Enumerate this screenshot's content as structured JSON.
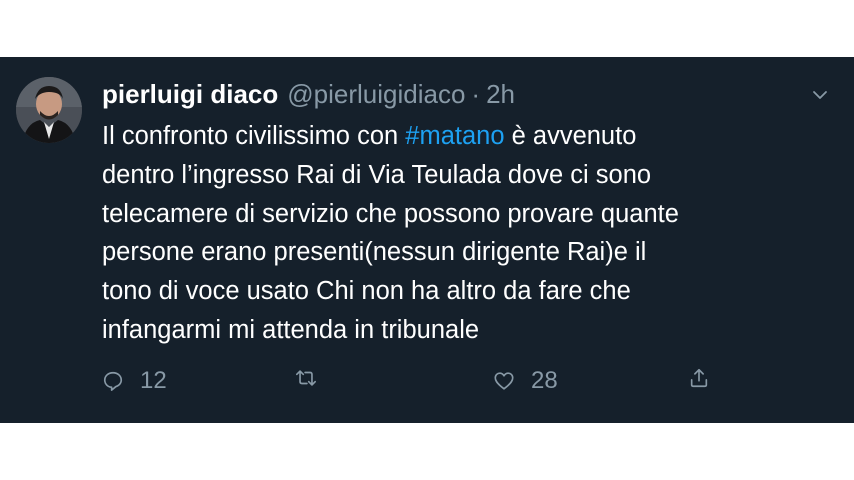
{
  "tweet": {
    "author_name": "pierluigi diaco",
    "handle": "@pierluigidiaco",
    "separator": "·",
    "time": "2h",
    "text_before": "Il confronto civilissimo con ",
    "hashtag": "#matano",
    "text_after": " è avvenuto\ndentro l’ingresso Rai di Via Teulada dove ci sono\ntelecamere di servizio che possono provare quante\npersone erano presenti(nessun dirigente Rai)e il\ntono di voce usato Chi non ha altro da fare che\ninfangarmi  mi attenda in tribunale",
    "reply_count": "12",
    "like_count": "28"
  },
  "icons": {
    "reply": "reply-icon",
    "retweet": "retweet-icon",
    "like": "heart-icon",
    "share": "share-icon",
    "menu": "chevron-down-icon"
  },
  "colors": {
    "background": "#15202b",
    "text": "#ffffff",
    "secondary": "#8899a6",
    "accent": "#1da1f2"
  }
}
